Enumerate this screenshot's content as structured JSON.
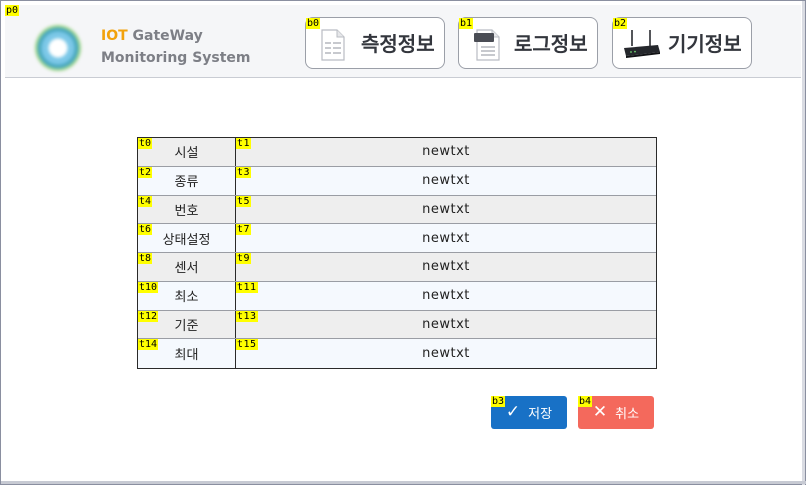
{
  "header": {
    "brand_line1_accent": "IOT",
    "brand_line1_rest": " GateWay",
    "brand_line2": "Monitoring System",
    "panel_tag": "p0"
  },
  "nav": [
    {
      "tag": "b0",
      "label": "측정정보",
      "icon": "document-icon"
    },
    {
      "tag": "b1",
      "label": "로그정보",
      "icon": "log-file-icon"
    },
    {
      "tag": "b2",
      "label": "기기정보",
      "icon": "router-icon"
    }
  ],
  "table": {
    "rows": [
      {
        "label_tag": "t0",
        "label": "시설",
        "value_tag": "t1",
        "value": "newtxt"
      },
      {
        "label_tag": "t2",
        "label": "종류",
        "value_tag": "t3",
        "value": "newtxt"
      },
      {
        "label_tag": "t4",
        "label": "번호",
        "value_tag": "t5",
        "value": "newtxt"
      },
      {
        "label_tag": "t6",
        "label": "상태설정",
        "value_tag": "t7",
        "value": "newtxt"
      },
      {
        "label_tag": "t8",
        "label": "센서",
        "value_tag": "t9",
        "value": "newtxt"
      },
      {
        "label_tag": "t10",
        "label": "최소",
        "value_tag": "t11",
        "value": "newtxt"
      },
      {
        "label_tag": "t12",
        "label": "기준",
        "value_tag": "t13",
        "value": "newtxt"
      },
      {
        "label_tag": "t14",
        "label": "최대",
        "value_tag": "t15",
        "value": "newtxt"
      }
    ]
  },
  "actions": {
    "save": {
      "tag": "b3",
      "label": "저장",
      "icon": "checkmark-icon",
      "color": "#1871c6"
    },
    "cancel": {
      "tag": "b4",
      "label": "취소",
      "icon": "close-icon",
      "color": "#f4695c"
    }
  }
}
